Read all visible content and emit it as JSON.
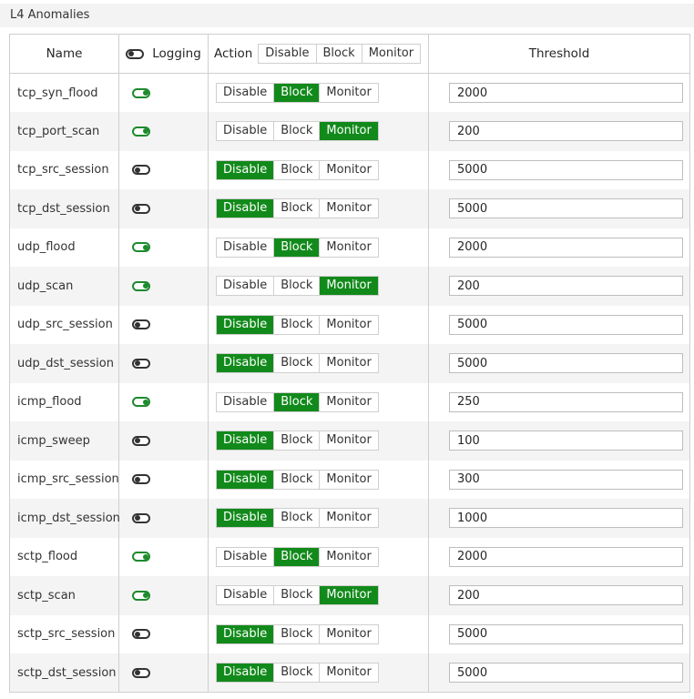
{
  "section_title": "L4 Anomalies",
  "headers": {
    "name": "Name",
    "logging": "Logging",
    "action": "Action",
    "threshold": "Threshold",
    "action_buttons": [
      "Disable",
      "Block",
      "Monitor"
    ]
  },
  "accent_color": "#128a1b",
  "rows": [
    {
      "name": "tcp_syn_flood",
      "logging": true,
      "action": "Block",
      "threshold": "2000"
    },
    {
      "name": "tcp_port_scan",
      "logging": true,
      "action": "Monitor",
      "threshold": "200"
    },
    {
      "name": "tcp_src_session",
      "logging": false,
      "action": "Disable",
      "threshold": "5000"
    },
    {
      "name": "tcp_dst_session",
      "logging": false,
      "action": "Disable",
      "threshold": "5000"
    },
    {
      "name": "udp_flood",
      "logging": true,
      "action": "Block",
      "threshold": "2000"
    },
    {
      "name": "udp_scan",
      "logging": true,
      "action": "Monitor",
      "threshold": "200"
    },
    {
      "name": "udp_src_session",
      "logging": false,
      "action": "Disable",
      "threshold": "5000"
    },
    {
      "name": "udp_dst_session",
      "logging": false,
      "action": "Disable",
      "threshold": "5000"
    },
    {
      "name": "icmp_flood",
      "logging": true,
      "action": "Block",
      "threshold": "250"
    },
    {
      "name": "icmp_sweep",
      "logging": false,
      "action": "Disable",
      "threshold": "100"
    },
    {
      "name": "icmp_src_session",
      "logging": false,
      "action": "Disable",
      "threshold": "300"
    },
    {
      "name": "icmp_dst_session",
      "logging": false,
      "action": "Disable",
      "threshold": "1000"
    },
    {
      "name": "sctp_flood",
      "logging": true,
      "action": "Block",
      "threshold": "2000"
    },
    {
      "name": "sctp_scan",
      "logging": true,
      "action": "Monitor",
      "threshold": "200"
    },
    {
      "name": "sctp_src_session",
      "logging": false,
      "action": "Disable",
      "threshold": "5000"
    },
    {
      "name": "sctp_dst_session",
      "logging": false,
      "action": "Disable",
      "threshold": "5000"
    }
  ]
}
